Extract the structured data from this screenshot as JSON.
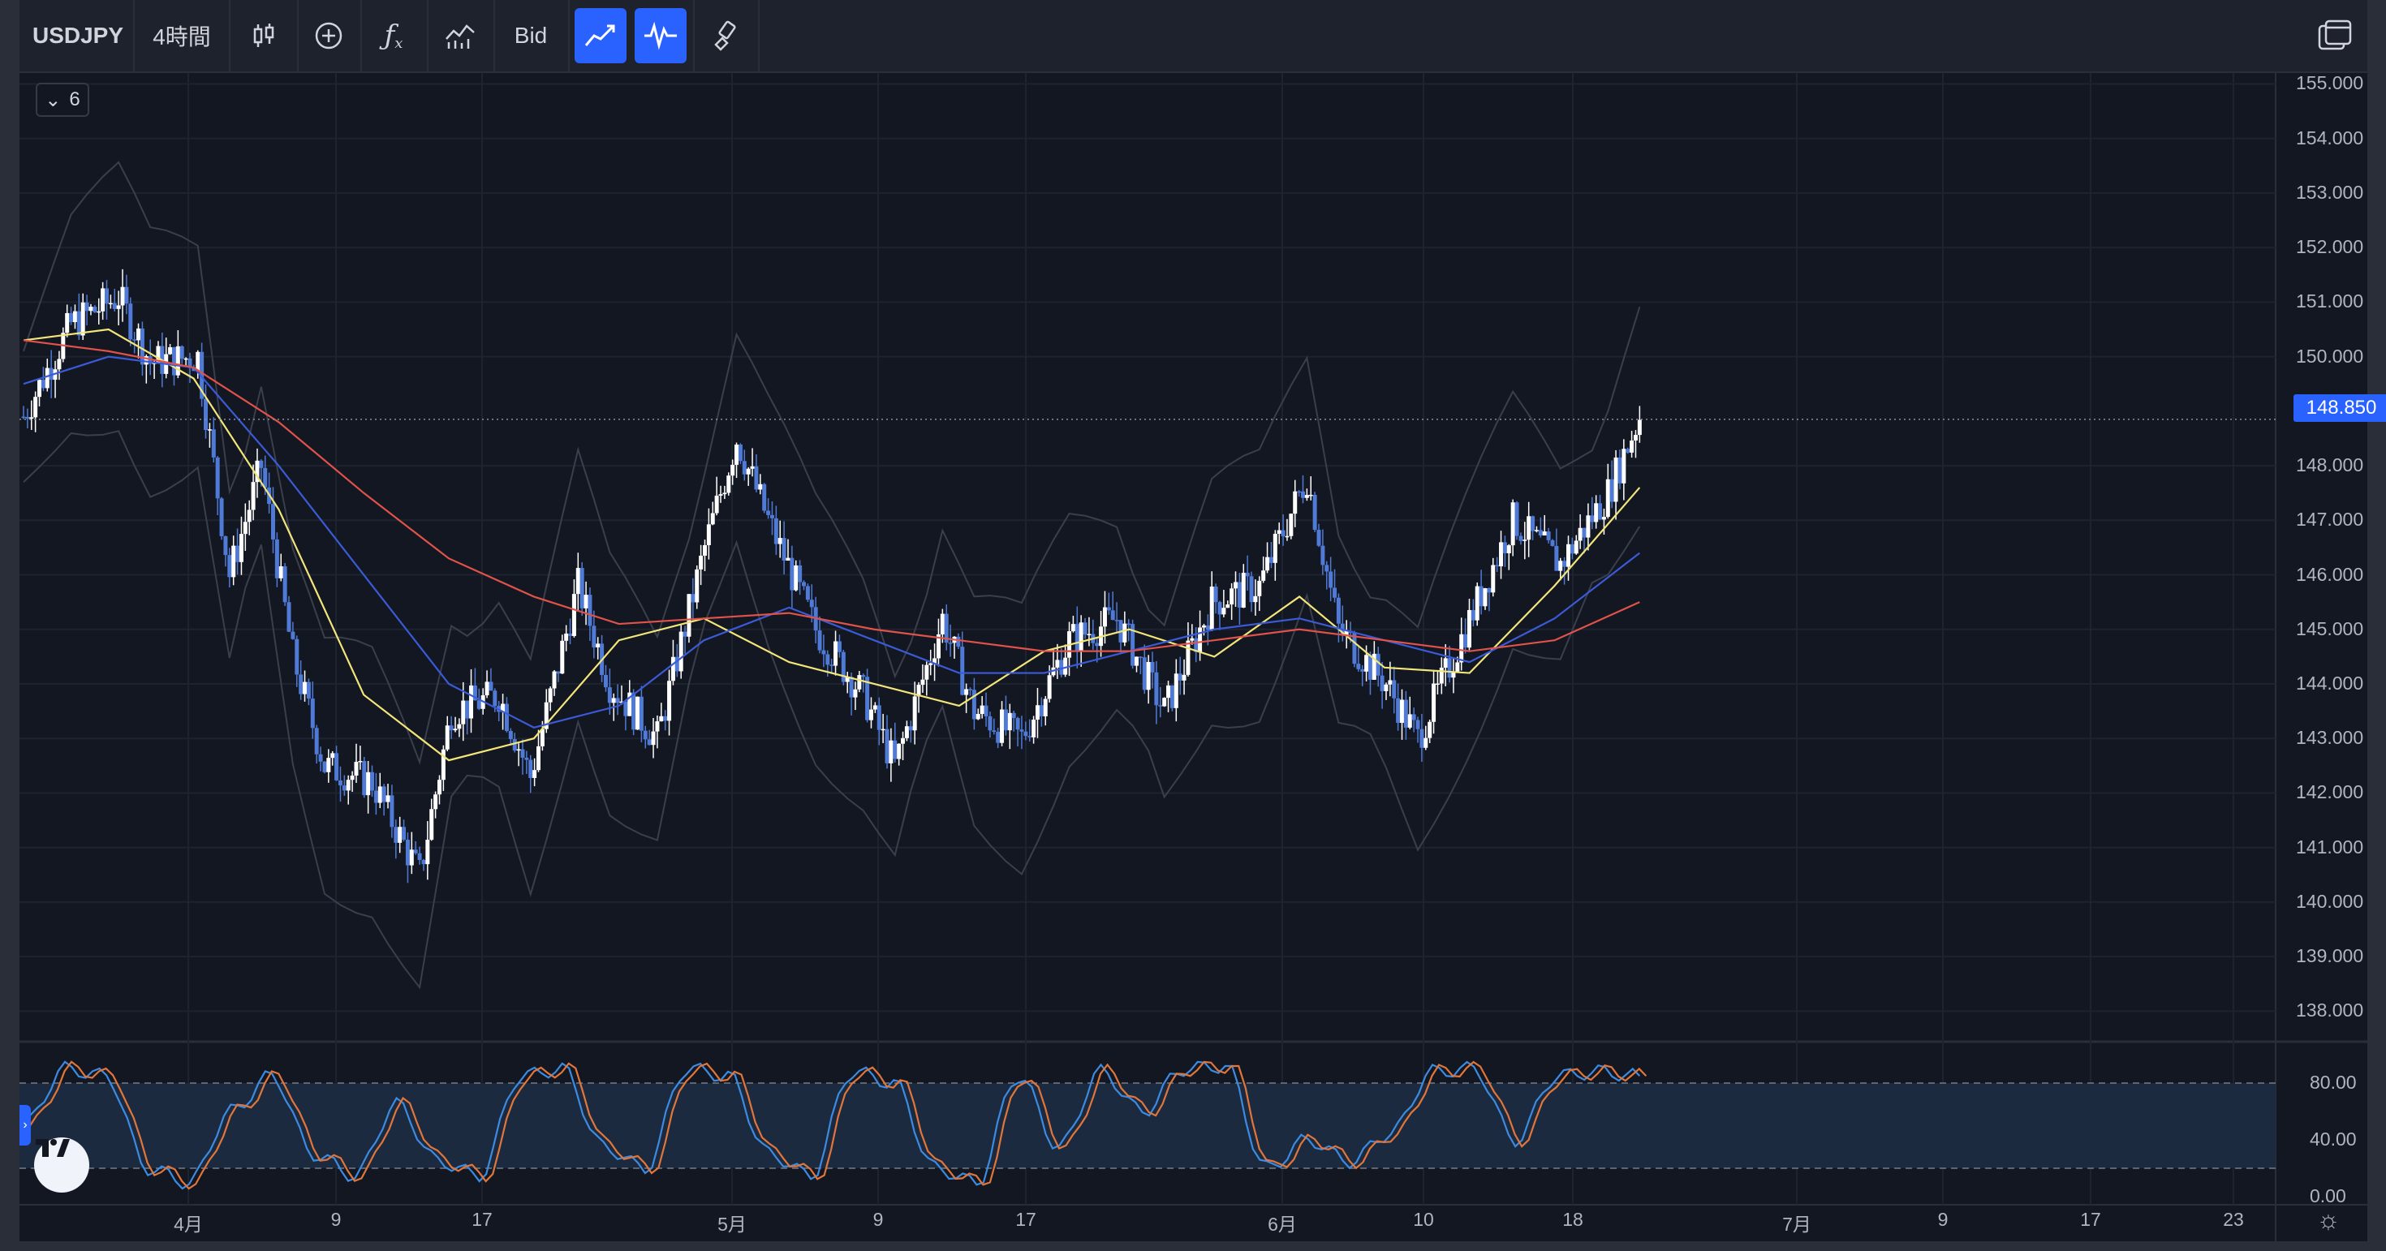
{
  "toolbar": {
    "symbol": "USDJPY",
    "interval": "4時間",
    "price_type": "Bid",
    "icons": [
      "candlestick-icon",
      "add-compare-icon",
      "indicators-icon",
      "templates-icon",
      "line-tool-icon",
      "oscillator-icon",
      "brush-icon",
      "layout-icon"
    ]
  },
  "legend_collapse": {
    "count": "6"
  },
  "last_price": "148.850",
  "price_axis": [
    "155.000",
    "154.000",
    "153.000",
    "152.000",
    "151.000",
    "150.000",
    "148.000",
    "147.000",
    "146.000",
    "145.000",
    "144.000",
    "143.000",
    "142.000",
    "141.000",
    "140.000",
    "139.000",
    "138.000"
  ],
  "osc_axis": [
    "80.00",
    "40.00",
    "0.00"
  ],
  "time_axis": [
    "4月",
    "9",
    "17",
    "5月",
    "9",
    "17",
    "6月",
    "10",
    "18",
    "7月",
    "9",
    "17",
    "23"
  ],
  "colors": {
    "background": "#131722",
    "candle_up": "#ffffff",
    "candle_down": "#4f7ad6",
    "ma_short": "#f2e57a",
    "ma_mid": "#3b5bd6",
    "ma_long": "#e0524a",
    "stoch_k": "#3d8be0",
    "stoch_d": "#e2763a",
    "accent": "#2962ff"
  },
  "chart_data": {
    "type": "candlestick",
    "symbol": "USDJPY",
    "interval": "4時間",
    "ylim": [
      137.5,
      155.2
    ],
    "x_ticks": [
      "4月",
      "9",
      "17",
      "5月",
      "9",
      "17",
      "6月",
      "10",
      "18",
      "7月",
      "9",
      "17",
      "23"
    ],
    "last_price": 148.85,
    "close_path": [
      {
        "x": 0,
        "y": 148.9
      },
      {
        "x": 6,
        "y": 150.6
      },
      {
        "x": 12,
        "y": 151.1
      },
      {
        "x": 16,
        "y": 149.9
      },
      {
        "x": 22,
        "y": 150.0
      },
      {
        "x": 26,
        "y": 146.0
      },
      {
        "x": 30,
        "y": 148.0
      },
      {
        "x": 34,
        "y": 144.5
      },
      {
        "x": 38,
        "y": 142.5
      },
      {
        "x": 44,
        "y": 142.2
      },
      {
        "x": 50,
        "y": 140.5
      },
      {
        "x": 54,
        "y": 143.5
      },
      {
        "x": 60,
        "y": 143.8
      },
      {
        "x": 64,
        "y": 142.3
      },
      {
        "x": 70,
        "y": 145.8
      },
      {
        "x": 74,
        "y": 144.0
      },
      {
        "x": 80,
        "y": 143.0
      },
      {
        "x": 86,
        "y": 146.5
      },
      {
        "x": 90,
        "y": 148.5
      },
      {
        "x": 94,
        "y": 147.0
      },
      {
        "x": 100,
        "y": 145.0
      },
      {
        "x": 106,
        "y": 143.8
      },
      {
        "x": 110,
        "y": 142.5
      },
      {
        "x": 116,
        "y": 145.2
      },
      {
        "x": 120,
        "y": 143.5
      },
      {
        "x": 126,
        "y": 143.0
      },
      {
        "x": 132,
        "y": 144.8
      },
      {
        "x": 138,
        "y": 145.2
      },
      {
        "x": 144,
        "y": 143.5
      },
      {
        "x": 150,
        "y": 145.5
      },
      {
        "x": 156,
        "y": 145.8
      },
      {
        "x": 162,
        "y": 147.8
      },
      {
        "x": 166,
        "y": 145.0
      },
      {
        "x": 172,
        "y": 144.0
      },
      {
        "x": 176,
        "y": 143.0
      },
      {
        "x": 182,
        "y": 145.0
      },
      {
        "x": 188,
        "y": 147.0
      },
      {
        "x": 194,
        "y": 146.2
      },
      {
        "x": 200,
        "y": 147.5
      },
      {
        "x": 204,
        "y": 148.9
      }
    ],
    "series": [
      {
        "values": [
          150.3,
          150.5,
          149.6,
          147.2,
          143.8,
          142.6,
          143.0,
          144.8,
          145.2,
          144.4,
          144.0,
          143.6,
          144.6,
          145.0,
          144.5,
          145.6,
          144.3,
          144.2,
          145.8,
          147.6
        ]
      },
      {
        "values": [
          149.5,
          150.0,
          149.8,
          148.0,
          146.0,
          144.0,
          143.2,
          143.6,
          144.8,
          145.4,
          144.8,
          144.2,
          144.2,
          144.6,
          145.0,
          145.2,
          144.8,
          144.4,
          145.2,
          146.4
        ]
      },
      {
        "values": [
          150.3,
          150.1,
          149.8,
          148.8,
          147.5,
          146.3,
          145.6,
          145.1,
          145.2,
          145.3,
          145.0,
          144.8,
          144.6,
          144.6,
          144.8,
          145.0,
          144.8,
          144.6,
          144.8,
          145.5
        ]
      }
    ],
    "stochastic": {
      "ylim": [
        0,
        100
      ],
      "levels": [
        80,
        20
      ],
      "k": [
        50,
        90,
        85,
        20,
        10,
        60,
        85,
        30,
        15,
        65,
        25,
        15,
        85,
        90,
        35,
        20,
        90,
        85,
        30,
        15,
        88,
        80,
        20,
        10,
        85,
        35,
        88,
        60,
        90,
        92,
        20,
        40,
        25,
        45,
        88,
        90,
        40,
        85,
        88,
        85
      ]
    }
  }
}
